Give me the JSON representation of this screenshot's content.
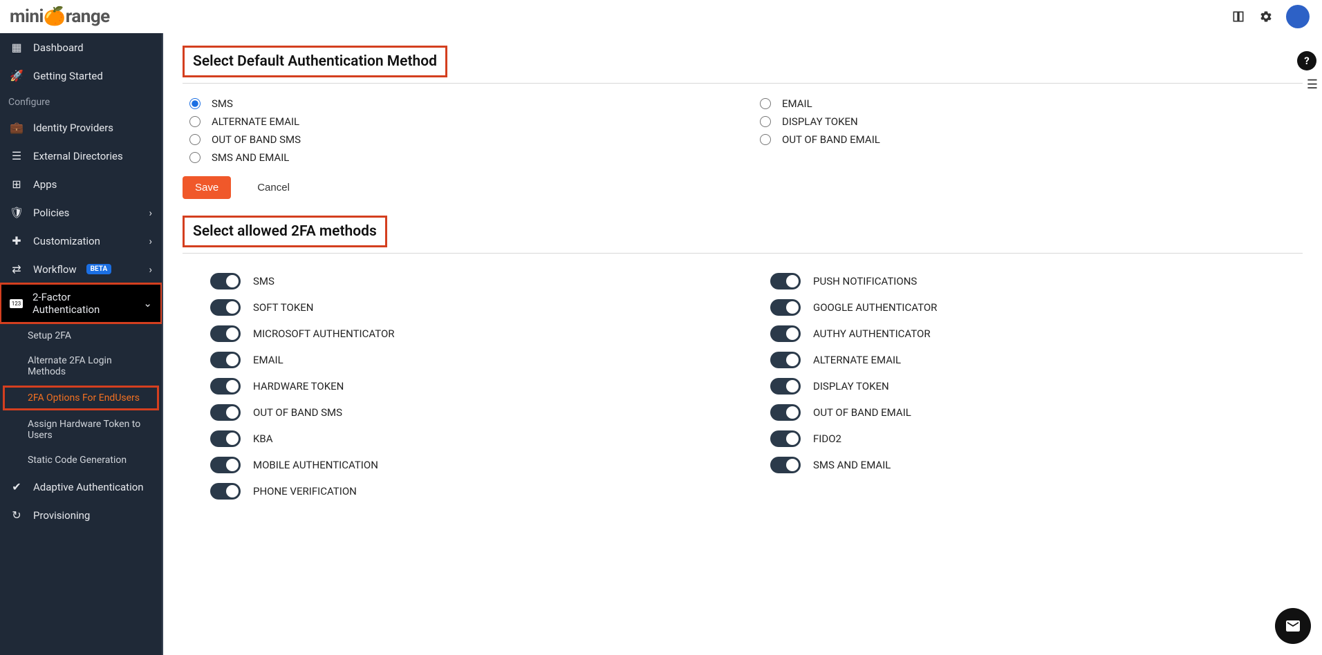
{
  "sidebar": {
    "dashboard": "Dashboard",
    "getting_started": "Getting Started",
    "configure_label": "Configure",
    "identity_providers": "Identity Providers",
    "external_directories": "External Directories",
    "apps": "Apps",
    "policies": "Policies",
    "customization": "Customization",
    "workflow": "Workflow",
    "beta": "BETA",
    "two_factor": "2-Factor Authentication",
    "adaptive": "Adaptive Authentication",
    "provisioning": "Provisioning",
    "sub": {
      "setup_2fa": "Setup 2FA",
      "alternate": "Alternate 2FA Login Methods",
      "endusers": "2FA Options For EndUsers",
      "hardware": "Assign Hardware Token to Users",
      "static_code": "Static Code Generation"
    }
  },
  "main": {
    "section1_title": "Select Default Authentication Method",
    "section2_title": "Select allowed 2FA methods",
    "save": "Save",
    "cancel": "Cancel",
    "radios_left": [
      {
        "label": "SMS",
        "checked": true
      },
      {
        "label": "ALTERNATE EMAIL",
        "checked": false
      },
      {
        "label": "OUT OF BAND SMS",
        "checked": false
      },
      {
        "label": "SMS AND EMAIL",
        "checked": false
      }
    ],
    "radios_right": [
      {
        "label": "EMAIL",
        "checked": false
      },
      {
        "label": "DISPLAY TOKEN",
        "checked": false
      },
      {
        "label": "OUT OF BAND EMAIL",
        "checked": false
      }
    ],
    "toggles_left": [
      {
        "label": "SMS",
        "on": true
      },
      {
        "label": "SOFT TOKEN",
        "on": true
      },
      {
        "label": "MICROSOFT AUTHENTICATOR",
        "on": true
      },
      {
        "label": "EMAIL",
        "on": true
      },
      {
        "label": "HARDWARE TOKEN",
        "on": true
      },
      {
        "label": "OUT OF BAND SMS",
        "on": true
      },
      {
        "label": "KBA",
        "on": true
      },
      {
        "label": "MOBILE AUTHENTICATION",
        "on": true
      },
      {
        "label": "PHONE VERIFICATION",
        "on": true
      }
    ],
    "toggles_right": [
      {
        "label": "PUSH NOTIFICATIONS",
        "on": true
      },
      {
        "label": "GOOGLE AUTHENTICATOR",
        "on": true
      },
      {
        "label": "AUTHY AUTHENTICATOR",
        "on": true
      },
      {
        "label": "ALTERNATE EMAIL",
        "on": true
      },
      {
        "label": "DISPLAY TOKEN",
        "on": true
      },
      {
        "label": "OUT OF BAND EMAIL",
        "on": true
      },
      {
        "label": "FIDO2",
        "on": true
      },
      {
        "label": "SMS AND EMAIL",
        "on": true
      }
    ]
  }
}
